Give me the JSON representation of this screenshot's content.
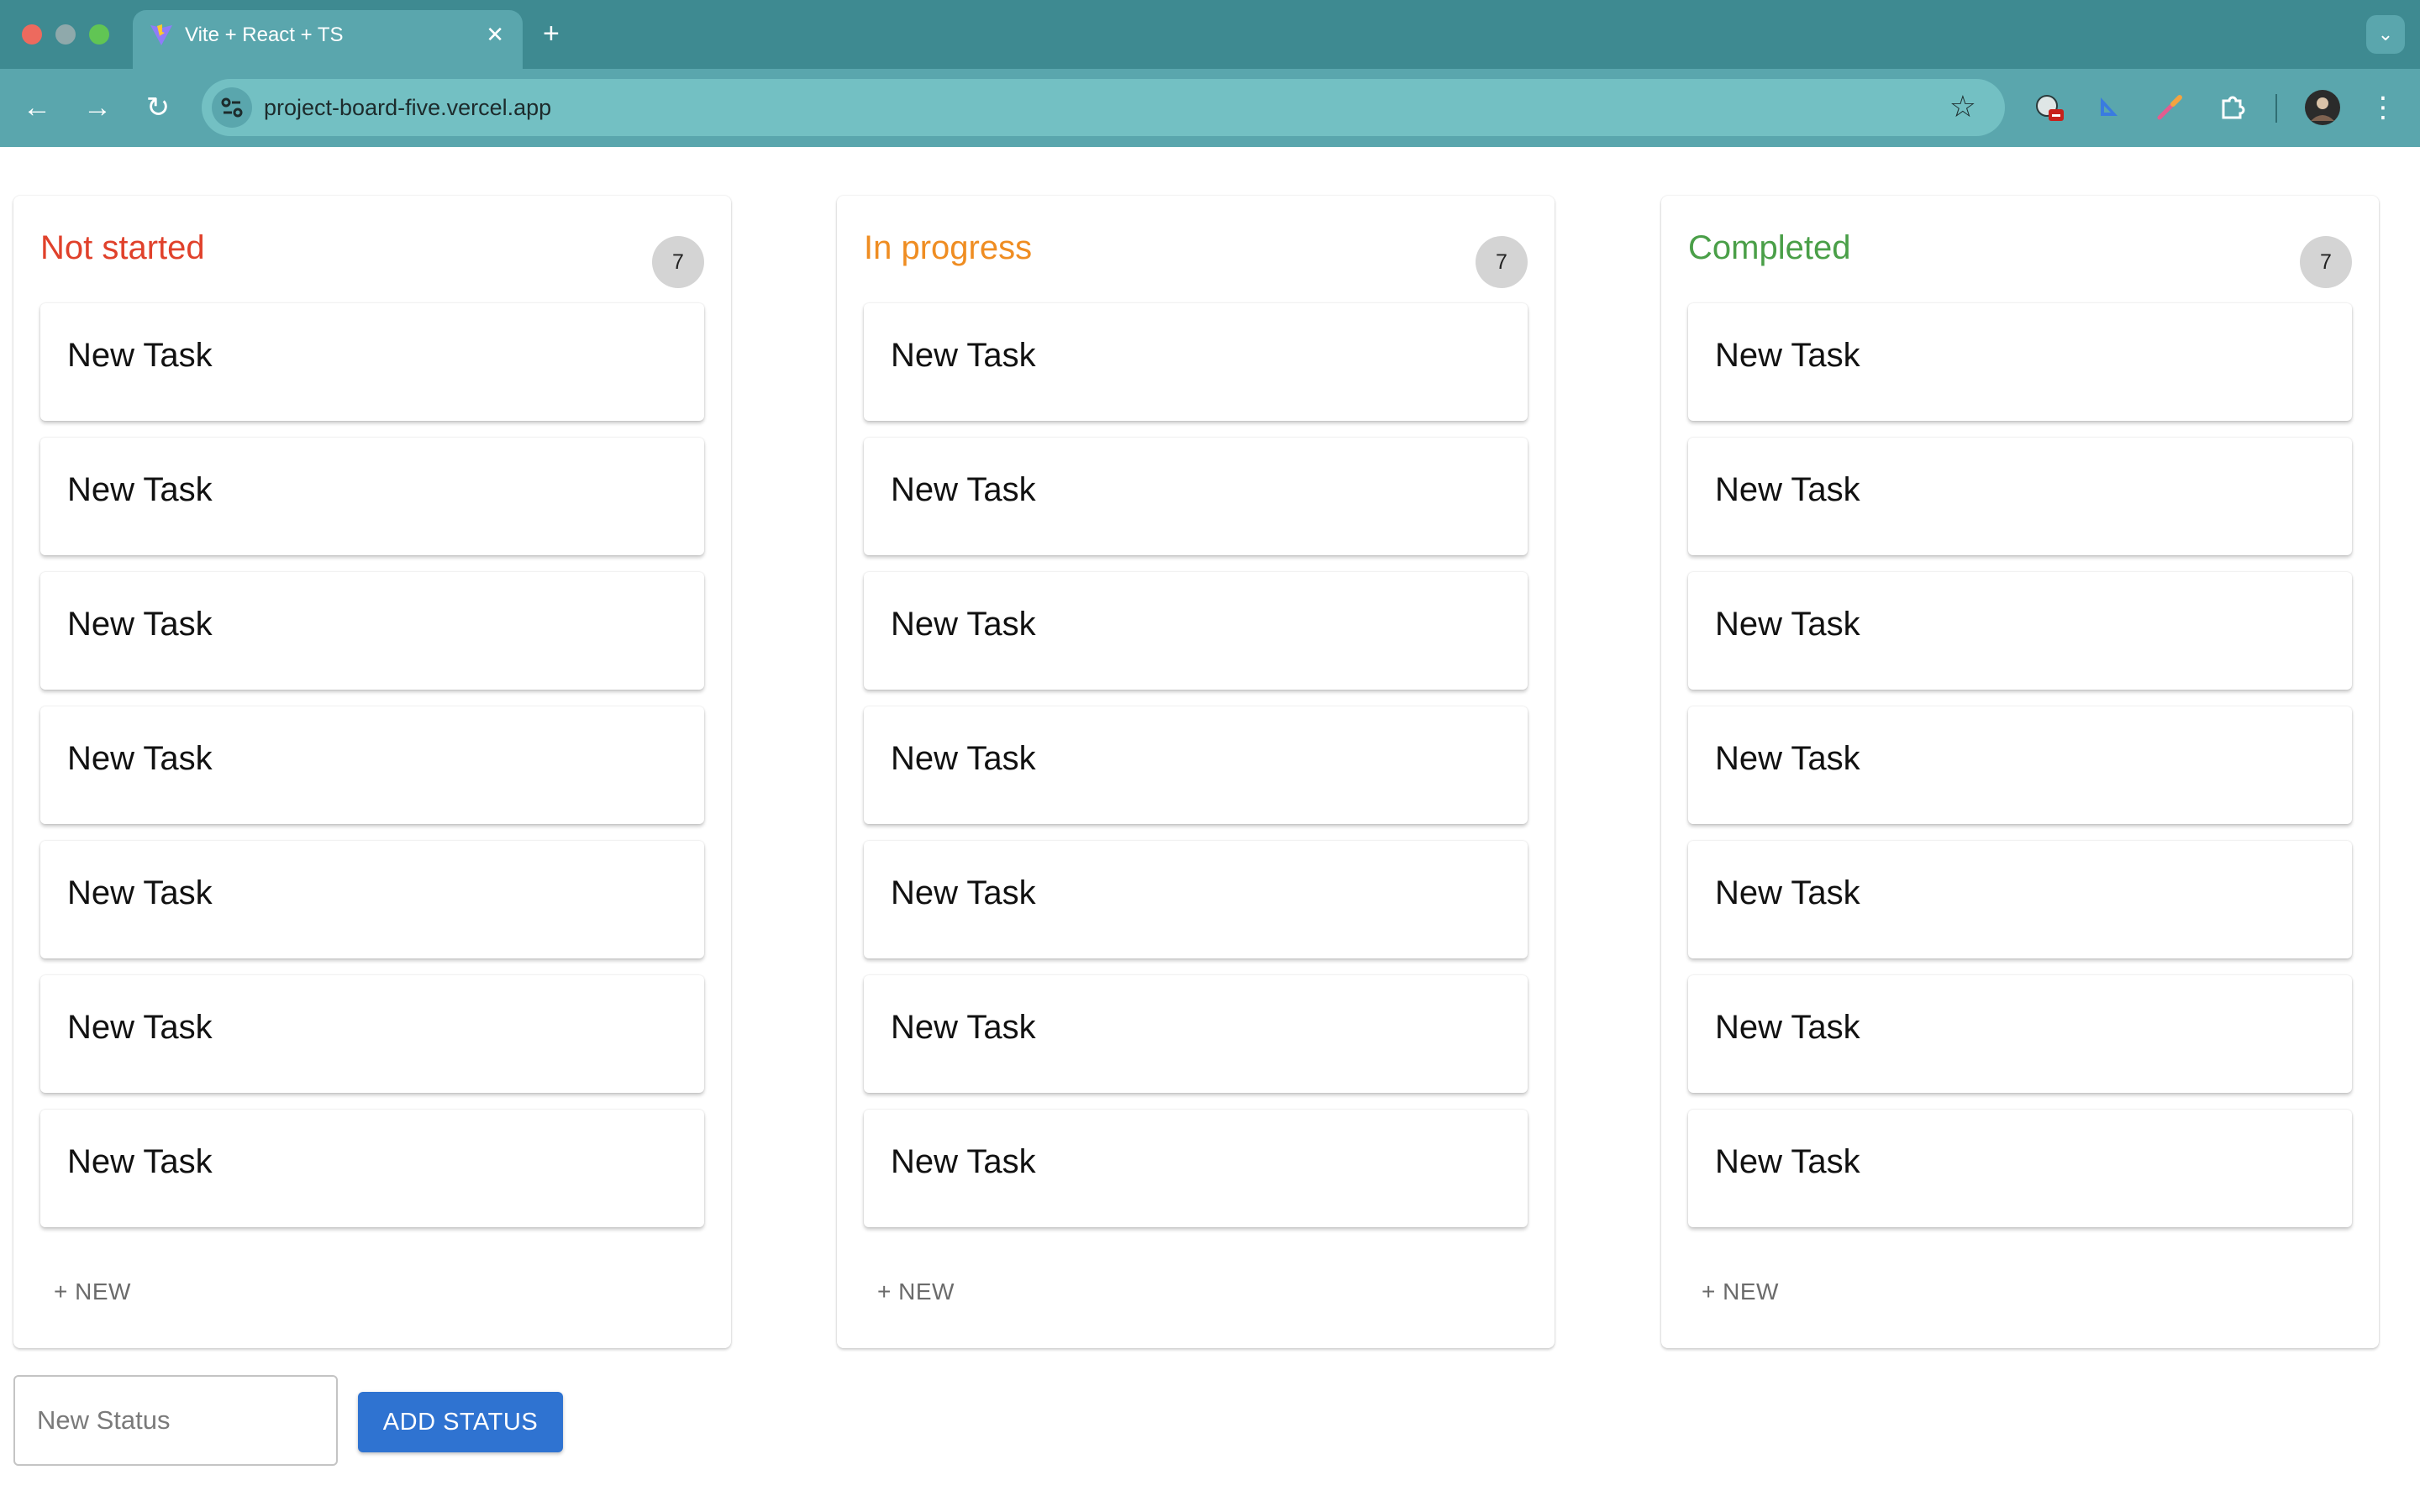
{
  "browser": {
    "tab_title": "Vite + React + TS",
    "tab_close": "✕",
    "new_tab": "+",
    "tab_menu": "⌄",
    "url": "project-board-five.vercel.app",
    "back": "←",
    "forward": "→",
    "reload": "↻",
    "star": "☆",
    "menu": "⋮"
  },
  "board": {
    "columns": [
      {
        "title": "Not started",
        "color": "#e0412b",
        "count": "7",
        "tasks": [
          "New Task",
          "New Task",
          "New Task",
          "New Task",
          "New Task",
          "New Task",
          "New Task"
        ],
        "new_label": "+ NEW"
      },
      {
        "title": "In progress",
        "color": "#ef8d22",
        "count": "7",
        "tasks": [
          "New Task",
          "New Task",
          "New Task",
          "New Task",
          "New Task",
          "New Task",
          "New Task"
        ],
        "new_label": "+ NEW"
      },
      {
        "title": "Completed",
        "color": "#4a9f48",
        "count": "7",
        "tasks": [
          "New Task",
          "New Task",
          "New Task",
          "New Task",
          "New Task",
          "New Task",
          "New Task"
        ],
        "new_label": "+ NEW"
      }
    ]
  },
  "footer": {
    "status_placeholder": "New Status",
    "status_value": "",
    "add_status_label": "ADD STATUS"
  }
}
